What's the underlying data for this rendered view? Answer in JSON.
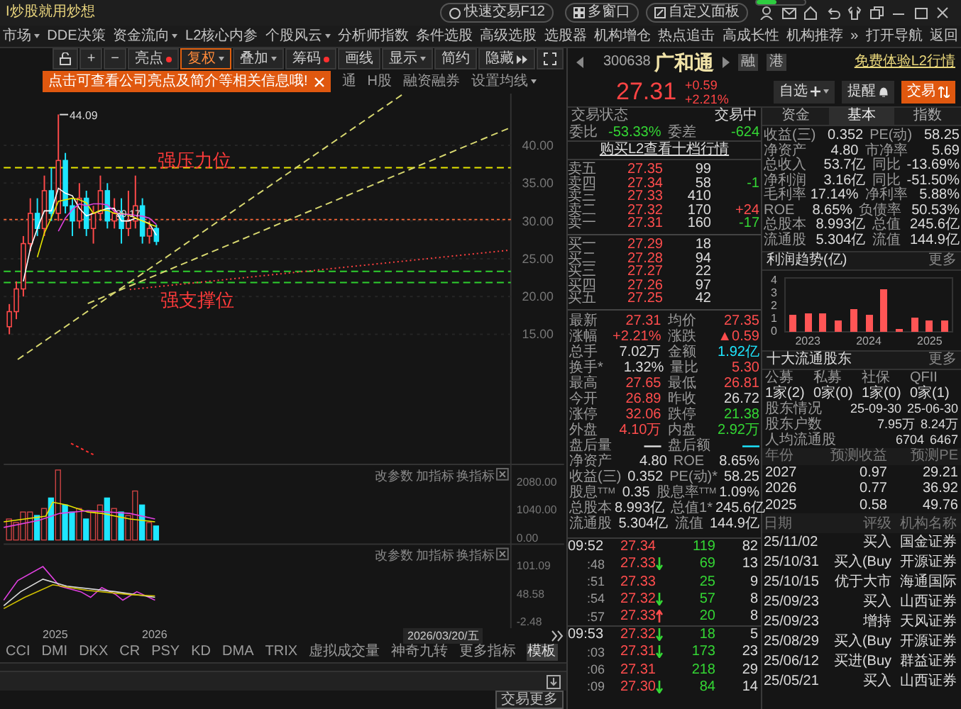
{
  "title_bar": {
    "slogan": "I炒股就用炒想",
    "quick_trade": "快速交易F12",
    "multi_window": "多窗口",
    "custom_panel": "自定义面板",
    "progress": {
      "level": 0.4
    }
  },
  "menu": [
    {
      "label": "市场",
      "dropdown": true
    },
    {
      "label": "DDE决策",
      "dropdown": false
    },
    {
      "label": "资金流向",
      "dropdown": true
    },
    {
      "label": "L2核心内参",
      "dropdown": false
    },
    {
      "label": "个股风云",
      "dropdown": true
    },
    {
      "label": "分析师指数",
      "dropdown": false
    },
    {
      "label": "条件选股",
      "dropdown": false
    },
    {
      "label": "高级选股",
      "dropdown": false
    },
    {
      "label": "选股器",
      "dropdown": false
    },
    {
      "label": "机构增仓",
      "dropdown": false
    },
    {
      "label": "热点追击",
      "dropdown": false
    },
    {
      "label": "高成长性",
      "dropdown": false
    },
    {
      "label": "机构推荐",
      "dropdown": false
    },
    {
      "label": "»",
      "dropdown": false
    },
    {
      "label": "打开导航",
      "dropdown": false
    },
    {
      "label": "返回",
      "dropdown": false
    }
  ],
  "toolbar": [
    {
      "label": "+",
      "kind": "plain",
      "selected": false
    },
    {
      "label": "−",
      "kind": "plain",
      "selected": false
    },
    {
      "label": "亮点",
      "kind": "dot",
      "selected": false
    },
    {
      "label": "复权",
      "kind": "dropdown",
      "selected": true
    },
    {
      "label": "叠加",
      "kind": "dropdown",
      "selected": false
    },
    {
      "label": "筹码",
      "kind": "dot",
      "selected": false
    },
    {
      "label": "画线",
      "kind": "plain",
      "selected": false
    },
    {
      "label": "显示",
      "kind": "dropdown",
      "selected": false
    },
    {
      "label": "简约",
      "kind": "plain",
      "selected": false
    },
    {
      "label": "隐藏",
      "kind": "expand",
      "selected": false
    }
  ],
  "tooltip": "点击可查看公司亮点及简介等相关信息哦!",
  "chart_tabs": [
    {
      "label": "通",
      "dropdown": false
    },
    {
      "label": "H股",
      "dropdown": false
    },
    {
      "label": "融资融券",
      "dropdown": false
    },
    {
      "label": "设置均线",
      "dropdown": true
    }
  ],
  "main_chart": {
    "y_labels": [
      "40.00",
      "35.00",
      "30.00",
      "25.00",
      "20.00",
      "15.00"
    ],
    "high_label": "44.09",
    "mid_label": "30.17",
    "resistance_label": "强压力位",
    "support_label": "强支撑位"
  },
  "volume_panel": {
    "actions": [
      "改参数",
      "加指标",
      "换指标"
    ],
    "y_labels": [
      "2080.00",
      "1040.00",
      "0.00"
    ]
  },
  "indicator_panel": {
    "actions": [
      "改参数",
      "加指标",
      "换指标"
    ],
    "y_labels": [
      "101.09",
      "48.58",
      "-2.48"
    ]
  },
  "x_labels": [
    "2025",
    "2026"
  ],
  "cursor_date": "2026/03/20/五",
  "indicator_tabs": [
    {
      "label": "CCI",
      "selected": false
    },
    {
      "label": "DMI",
      "selected": false
    },
    {
      "label": "DKX",
      "selected": false
    },
    {
      "label": "CR",
      "selected": false
    },
    {
      "label": "PSY",
      "selected": false
    },
    {
      "label": "KD",
      "selected": false
    },
    {
      "label": "DMA",
      "selected": false
    },
    {
      "label": "TRIX",
      "selected": false
    },
    {
      "label": "虚拟成交量",
      "selected": false
    },
    {
      "label": "神奇九转",
      "selected": false
    },
    {
      "label": "更多指标",
      "selected": false
    },
    {
      "label": "模板",
      "selected": true
    }
  ],
  "bottom_button": "交易更多",
  "stock": {
    "code": "300638",
    "name": "广和通",
    "tags": [
      "融",
      "港"
    ],
    "l2_link": "免费体验L2行情",
    "price": "27.31",
    "change": "+0.59",
    "change_pct": "+2.21%",
    "buttons": [
      {
        "label": "自选",
        "kind": "watch"
      },
      {
        "label": "提醒",
        "kind": "alert"
      },
      {
        "label": "交易",
        "kind": "trade"
      }
    ]
  },
  "quote": {
    "status_label": "交易状态",
    "status": "交易中",
    "ratio_label": "委比",
    "ratio": "-53.33%",
    "diff_label": "委差",
    "diff": "-624",
    "l2_link": "购买L2查看十档行情",
    "asks": [
      {
        "label": "卖五",
        "price": "27.35",
        "volume": "99"
      },
      {
        "label": "卖四",
        "price": "27.34",
        "volume": "58",
        "change": "-1",
        "color": "#34d634"
      },
      {
        "label": "卖三",
        "price": "27.33",
        "volume": "410"
      },
      {
        "label": "卖二",
        "price": "27.32",
        "volume": "170",
        "change": "+24",
        "color": "#ff4d4d"
      },
      {
        "label": "卖一",
        "price": "27.31",
        "volume": "160",
        "change": "-17",
        "color": "#34d634"
      }
    ],
    "bids": [
      {
        "label": "买一",
        "price": "27.29",
        "volume": "18"
      },
      {
        "label": "买二",
        "price": "27.28",
        "volume": "94"
      },
      {
        "label": "买三",
        "price": "27.27",
        "volume": "22"
      },
      {
        "label": "买四",
        "price": "27.26",
        "volume": "97"
      },
      {
        "label": "买五",
        "price": "27.25",
        "volume": "42"
      }
    ],
    "stats": [
      [
        {
          "label": "最新",
          "value": "27.31",
          "color": "#ff4d4d"
        },
        {
          "label": "均价",
          "value": "27.35",
          "color": "#ff4d4d"
        }
      ],
      [
        {
          "label": "涨幅",
          "value": "+2.21%",
          "color": "#ff4d4d"
        },
        {
          "label": "涨跌",
          "value": "▲0.59",
          "color": "#ff4d4d"
        }
      ],
      [
        {
          "label": "总手",
          "value": "7.02万",
          "color": "#dcdcdc"
        },
        {
          "label": "金额",
          "value": "1.92亿",
          "color": "#1ee6ff"
        }
      ],
      [
        {
          "label": "换手*",
          "value": "1.32%",
          "color": "#dcdcdc"
        },
        {
          "label": "量比",
          "value": "5.30",
          "color": "#ff4d4d"
        }
      ],
      [
        {
          "label": "最高",
          "value": "27.65",
          "color": "#ff4d4d"
        },
        {
          "label": "最低",
          "value": "26.81",
          "color": "#ff4d4d"
        }
      ],
      [
        {
          "label": "今开",
          "value": "26.89",
          "color": "#ff4d4d"
        },
        {
          "label": "昨收",
          "value": "26.72",
          "color": "#dcdcdc"
        }
      ],
      [
        {
          "label": "涨停",
          "value": "32.06",
          "color": "#ff4d4d"
        },
        {
          "label": "跌停",
          "value": "21.38",
          "color": "#34d634"
        }
      ],
      [
        {
          "label": "外盘",
          "value": "4.10万",
          "color": "#ff4d4d"
        },
        {
          "label": "内盘",
          "value": "2.92万",
          "color": "#34d634"
        }
      ],
      [
        {
          "label": "盘后量",
          "value": "—",
          "color": "#dcdcdc"
        },
        {
          "label": "盘后额",
          "value": "—",
          "color": "#1ee6ff"
        }
      ],
      [
        {
          "label": "净资产",
          "value": "4.80",
          "color": "#dcdcdc"
        },
        {
          "label": "ROE",
          "value": "8.65%",
          "color": "#dcdcdc"
        }
      ],
      [
        {
          "label": "收益(三)",
          "value": "0.352",
          "color": "#dcdcdc"
        },
        {
          "label": "PE(动)*",
          "value": "58.25",
          "color": "#dcdcdc"
        }
      ],
      [
        {
          "label": "股息$^{TTM}$",
          "value": "0.35",
          "color": "#dcdcdc"
        },
        {
          "label": "股息率$^{TTM}$",
          "value": "1.09%",
          "color": "#dcdcdc"
        }
      ],
      [
        {
          "label": "总股本",
          "value": "8.993亿",
          "color": "#dcdcdc"
        },
        {
          "label": "总值1*",
          "value": "245.6亿",
          "color": "#dcdcdc"
        }
      ],
      [
        {
          "label": "流通股",
          "value": "5.304亿",
          "color": "#dcdcdc"
        },
        {
          "label": "流值",
          "value": "144.9亿",
          "color": "#dcdcdc"
        }
      ]
    ]
  },
  "ticks": [
    {
      "time": "09:52",
      "kind": "minute",
      "price": "27.34",
      "up_arrow": false,
      "down_arrow": false,
      "volume": "119",
      "count": "82"
    },
    {
      "time": ":48",
      "kind": "second",
      "price": "27.33",
      "up_arrow": false,
      "down_arrow": true,
      "volume": "69",
      "count": "13"
    },
    {
      "time": ":51",
      "kind": "second",
      "price": "27.33",
      "up_arrow": false,
      "down_arrow": false,
      "volume": "25",
      "count": "9"
    },
    {
      "time": ":54",
      "kind": "second",
      "price": "27.32",
      "up_arrow": false,
      "down_arrow": true,
      "volume": "57",
      "count": "8"
    },
    {
      "time": ":57",
      "kind": "second",
      "price": "27.33",
      "up_arrow": true,
      "down_arrow": false,
      "volume": "20",
      "count": "8"
    },
    {
      "time": "09:53",
      "kind": "minute",
      "price": "27.32",
      "up_arrow": false,
      "down_arrow": true,
      "volume": "18",
      "count": "5"
    },
    {
      "time": ":03",
      "kind": "second",
      "price": "27.31",
      "up_arrow": false,
      "down_arrow": true,
      "volume": "173",
      "count": "23"
    },
    {
      "time": ":06",
      "kind": "second",
      "price": "27.31",
      "up_arrow": false,
      "down_arrow": false,
      "volume": "218",
      "count": "29"
    },
    {
      "time": ":09",
      "kind": "second",
      "price": "27.30",
      "up_arrow": false,
      "down_arrow": true,
      "volume": "84",
      "count": "14"
    }
  ],
  "info_tabs": [
    {
      "label": "资金",
      "selected": false
    },
    {
      "label": "基本",
      "selected": true
    },
    {
      "label": "指数",
      "selected": false
    }
  ],
  "fundamentals": [
    {
      "label": "收益(三)",
      "value": "0.352",
      "label2": "PE(动)",
      "value2": "58.25"
    },
    {
      "label": "净资产",
      "value": "4.80",
      "label2": "市净率",
      "value2": "5.69"
    },
    {
      "label": "总收入",
      "value": "53.7亿",
      "label2": "同比",
      "value2": "-13.69%"
    },
    {
      "label": "净利润",
      "value": "3.16亿",
      "label2": "同比",
      "value2": "-51.50%"
    },
    {
      "label": "毛利率",
      "value": "17.14%",
      "label2": "净利率",
      "value2": "5.88%"
    },
    {
      "label": "ROE",
      "value": "8.65%",
      "label2": "负债率",
      "value2": "50.53%"
    },
    {
      "label": "总股本",
      "value": "8.993亿",
      "label2": "总值",
      "value2": "245.6亿"
    },
    {
      "label": "流通股",
      "value": "5.304亿",
      "label2": "流值",
      "value2": "144.9亿"
    }
  ],
  "profit_trend": {
    "more": "更多",
    "chart_data": {
      "type": "bar",
      "title": "利润趋势(亿)",
      "categories": [
        null,
        "2023",
        null,
        null,
        null,
        "2024",
        null,
        null,
        null,
        "2025",
        null
      ],
      "ylim": [
        0,
        4
      ],
      "yticks": [
        0,
        1,
        2,
        3,
        4
      ],
      "series": [
        {
          "color": "#ff5555",
          "values": [
            1.3,
            1.5,
            1.4,
            0.9,
            1.8,
            1.3,
            3.3,
            0.2,
            1.1,
            0.9,
            0.9
          ]
        }
      ]
    }
  },
  "holders": {
    "title": "十大流通股东",
    "more": "更多",
    "types": [
      "公募",
      "私募",
      "社保",
      "QFII"
    ],
    "counts": [
      "1家(2)",
      "0家(0)",
      "1家(0)",
      "0家(1)"
    ],
    "rows": [
      {
        "label": "股东情况",
        "values": [
          "25-09-30",
          "25-06-30"
        ]
      },
      {
        "label": "股东户数",
        "values": [
          "7.95万",
          "8.24万"
        ]
      },
      {
        "label": "人均流通股",
        "values": [
          "6704",
          "6467"
        ]
      }
    ]
  },
  "forecast": {
    "columns": [
      "年份",
      "预测收益",
      "预测PE"
    ],
    "rows": [
      [
        "2027",
        "0.97",
        "29.21"
      ],
      [
        "2026",
        "0.77",
        "36.92"
      ],
      [
        "2025",
        "0.58",
        "49.76"
      ]
    ]
  },
  "ratings": {
    "columns": [
      "日期",
      "评级",
      "机构名称"
    ],
    "rows": [
      [
        "25/11/02",
        "买入",
        "国金证券"
      ],
      [
        "25/10/31",
        "买入(Buy",
        "开源证券"
      ],
      [
        "25/10/15",
        "优于大市",
        "海通国际"
      ],
      [
        "25/09/23",
        "买入",
        "山西证券"
      ],
      [
        "25/09/23",
        "增持",
        "天风证券"
      ],
      [
        "25/08/29",
        "买入(Buy",
        "开源证券"
      ],
      [
        "25/06/12",
        "买进(Buy",
        "群益证券"
      ],
      [
        "25/05/21",
        "买入",
        "山西证券"
      ]
    ]
  }
}
